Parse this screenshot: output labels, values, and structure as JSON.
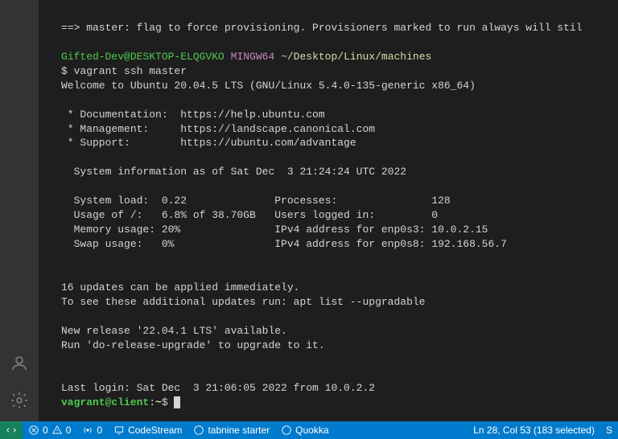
{
  "terminal": {
    "provisioners_tail": "==> master: flag to force provisioning. Provisioners marked to run always will stil",
    "prompt_user": "Gifted-Dev@DESKTOP-ELQGVKO",
    "prompt_env": "MINGW64",
    "prompt_path": "~/Desktop/Linux/machines",
    "command": "$ vagrant ssh master",
    "welcome": "Welcome to Ubuntu 20.04.5 LTS (GNU/Linux 5.4.0-135-generic x86_64)",
    "links": [
      " * Documentation:  https://help.ubuntu.com",
      " * Management:     https://landscape.canonical.com",
      " * Support:        https://ubuntu.com/advantage"
    ],
    "sysinfo_header": "  System information as of Sat Dec  3 21:24:24 UTC 2022",
    "sysinfo": [
      "  System load:  0.22              Processes:               128",
      "  Usage of /:   6.8% of 38.70GB   Users logged in:         0",
      "  Memory usage: 20%               IPv4 address for enp0s3: 10.0.2.15",
      "  Swap usage:   0%                IPv4 address for enp0s8: 192.168.56.7"
    ],
    "updates1": "16 updates can be applied immediately.",
    "updates2": "To see these additional updates run: apt list --upgradable",
    "release1": "New release '22.04.1 LTS' available.",
    "release2": "Run 'do-release-upgrade' to upgrade to it.",
    "last_login": "Last login: Sat Dec  3 21:06:05 2022 from 10.0.2.2",
    "ssh_user_host": "vagrant@client",
    "ssh_colon": ":",
    "ssh_path": "~",
    "ssh_dollar": "$ "
  },
  "statusbar": {
    "errors": "0",
    "warnings": "0",
    "ports": "0",
    "codestream": "CodeStream",
    "tabnine": "tabnine starter",
    "quokka": "Quokka",
    "cursor": "Ln 28, Col 53 (183 selected)",
    "s": "S"
  }
}
